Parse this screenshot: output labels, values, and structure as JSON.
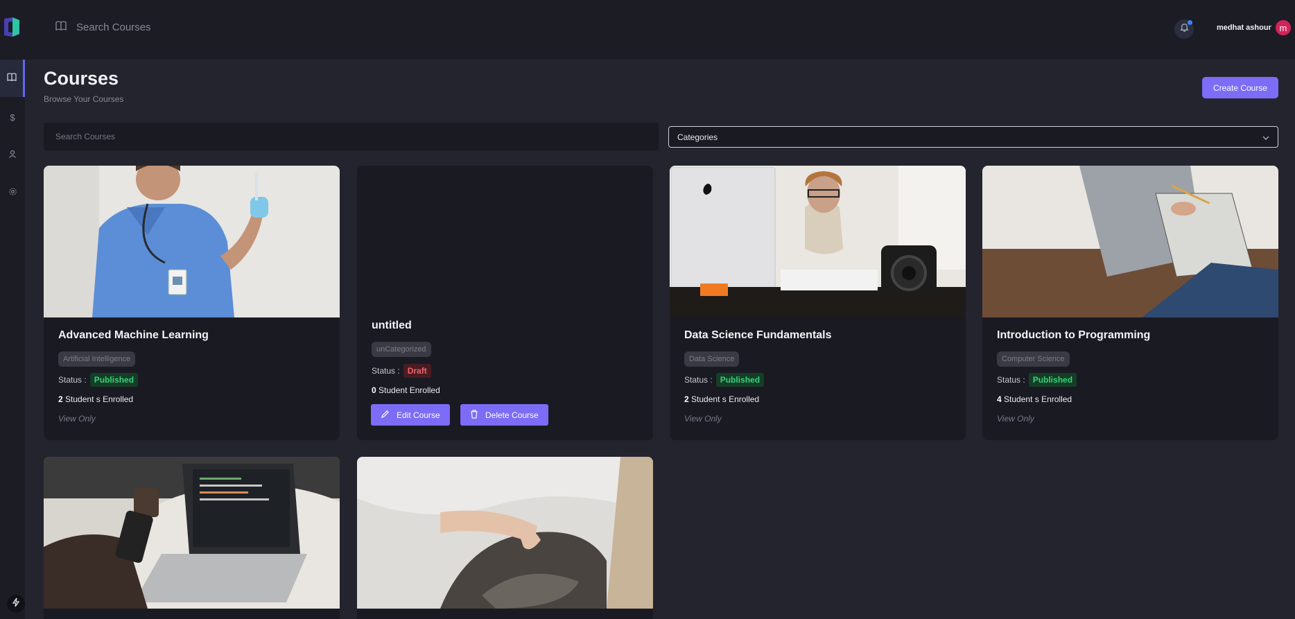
{
  "header": {
    "search_placeholder": "Search Courses",
    "user_name": "medhat ashour",
    "user_initial": "m"
  },
  "page": {
    "title": "Courses",
    "subtitle": "Browse Your Courses",
    "create_label": "Create Course",
    "search_placeholder": "Search Courses",
    "category_value": "Categories"
  },
  "labels": {
    "status": "Status :",
    "view_only": "View Only",
    "edit": "Edit Course",
    "delete": "Delete Course"
  },
  "courses": [
    {
      "title": "Advanced Machine Learning",
      "category": "Artificial Intelligence",
      "status": "Published",
      "count": "2",
      "enrolled": "Student s Enrolled"
    },
    {
      "title": "untitled",
      "category": "unCategorized",
      "status": "Draft",
      "count": "0",
      "enrolled": "Student Enrolled"
    },
    {
      "title": "Data Science Fundamentals",
      "category": "Data Science",
      "status": "Published",
      "count": "2",
      "enrolled": "Student s Enrolled"
    },
    {
      "title": "Introduction to Programming",
      "category": "Computer Science",
      "status": "Published",
      "count": "4",
      "enrolled": "Student s Enrolled"
    }
  ],
  "colors": {
    "accent": "#7c6cf6",
    "published": "#34d37a",
    "draft": "#f0616f",
    "avatar": "#d3245a"
  },
  "icons": [
    "book-icon",
    "dollar-icon",
    "user-icon",
    "gear-icon",
    "bell-icon",
    "chevron-down-icon",
    "pencil-icon",
    "trash-icon",
    "bolt-icon"
  ]
}
